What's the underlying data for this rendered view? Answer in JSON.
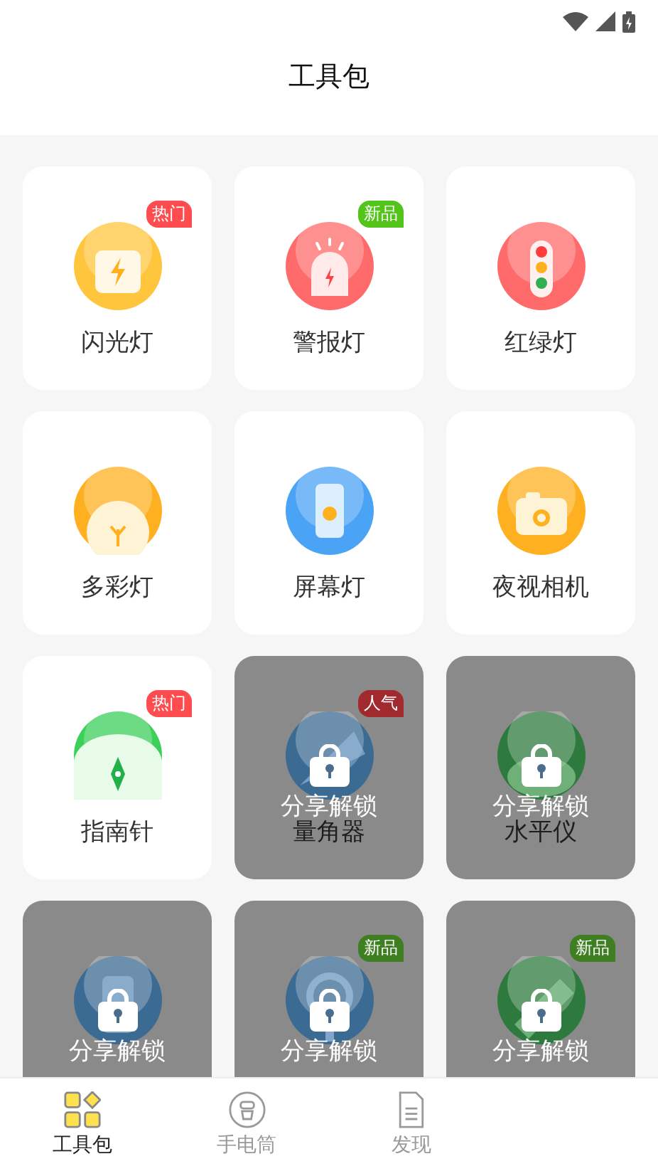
{
  "header": {
    "title": "工具包"
  },
  "tools": [
    {
      "name": "闪光灯",
      "kind": "flash",
      "color": "#ffc53d",
      "badge": {
        "text": "热门",
        "color": "#ff4d4f"
      },
      "locked": false
    },
    {
      "name": "警报灯",
      "kind": "alarm",
      "color": "#ff6b6b",
      "badge": {
        "text": "新品",
        "color": "#52c41a"
      },
      "locked": false
    },
    {
      "name": "红绿灯",
      "kind": "traffic",
      "color": "#ff6b6b",
      "locked": false
    },
    {
      "name": "多彩灯",
      "kind": "lamp",
      "color": "#ffb020",
      "locked": false
    },
    {
      "name": "屏幕灯",
      "kind": "screen",
      "color": "#4aa3f5",
      "locked": false
    },
    {
      "name": "夜视相机",
      "kind": "camera",
      "color": "#ffb020",
      "locked": false
    },
    {
      "name": "指南针",
      "kind": "compass",
      "color": "#3ccf5a",
      "badge": {
        "text": "热门",
        "color": "#ff4d4f"
      },
      "locked": false
    },
    {
      "name": "量角器",
      "kind": "protractor",
      "color": "#3b6a93",
      "badge": {
        "text": "人气",
        "color": "#a12a2e"
      },
      "locked": true,
      "unlock_label": "分享解锁"
    },
    {
      "name": "水平仪",
      "kind": "level",
      "color": "#2e7a3e",
      "locked": true,
      "unlock_label": "分享解锁"
    },
    {
      "kind": "phone",
      "color": "#3b6a93",
      "locked": true,
      "unlock_label": "分享解锁"
    },
    {
      "kind": "magnifier",
      "color": "#3b6a93",
      "badge": {
        "text": "新品",
        "color": "#3f7f22"
      },
      "locked": true,
      "unlock_label": "分享解锁"
    },
    {
      "kind": "ruler",
      "color": "#2e7a3e",
      "badge": {
        "text": "新品",
        "color": "#3f7f22"
      },
      "locked": true,
      "unlock_label": "分享解锁"
    }
  ],
  "tabs": [
    {
      "label": "工具包",
      "selected": true
    },
    {
      "label": "手电筒",
      "selected": false
    },
    {
      "label": "发现",
      "selected": false
    }
  ]
}
